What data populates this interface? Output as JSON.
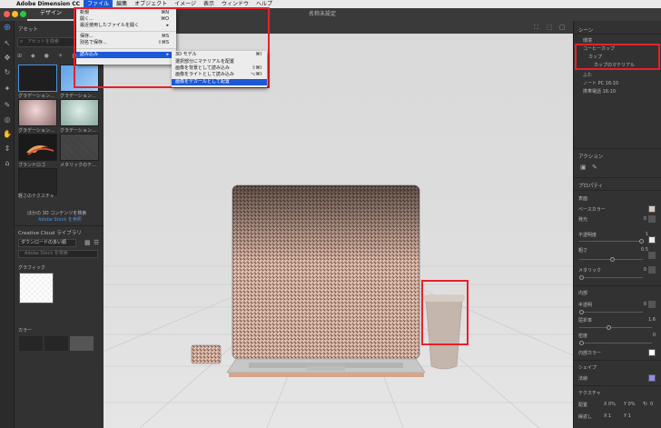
{
  "menubar": {
    "app": "Adobe Dimension CC",
    "items": [
      "ファイル",
      "編集",
      "オブジェクト",
      "イメージ",
      "表示",
      "ウィンドウ",
      "ヘルプ"
    ]
  },
  "window": {
    "title": "名称未設定",
    "tab": "デザイン"
  },
  "assets": {
    "title": "アセット",
    "search_placeholder": "アセットを検索",
    "thumbs": [
      "グラデーション…",
      "グラデーション…",
      "グラデーション…",
      "グラデーション…",
      "ブランドロゴ",
      "メタリックのテ…",
      "軽さのテクスチャ"
    ],
    "more_text": "ほかの 3D コンテンツを検索",
    "stock_link": "Adobe Stock を参照",
    "cc_title": "Creative Cloud ライブラリ",
    "cc_dropdown": "ダウンロードの多い順",
    "cc_search_placeholder": "Adobe Stock を検索",
    "group_graphics": "グラフィック",
    "group_colors": "カラー"
  },
  "file_menu": {
    "items": [
      {
        "label": "新規",
        "shortcut": "⌘N"
      },
      {
        "label": "開く...",
        "shortcut": "⌘O"
      },
      {
        "label": "最近使用したファイルを開く",
        "shortcut": "▸"
      },
      {
        "label": "保存...",
        "shortcut": "⌘S"
      },
      {
        "label": "別名で保存...",
        "shortcut": "⇧⌘S"
      },
      {
        "label": "読み込み",
        "shortcut": "▸"
      }
    ]
  },
  "import_submenu": {
    "items": [
      {
        "label": "3D モデル",
        "shortcut": "⌘I"
      },
      {
        "label": "選択部分にマテリアルを配置",
        "shortcut": ""
      },
      {
        "label": "画像を背景として読み込み",
        "shortcut": "⇧⌘I"
      },
      {
        "label": "画像をライトとして読み込み",
        "shortcut": "⌥⌘I"
      },
      {
        "label": "画像をデカールとして配置",
        "shortcut": ""
      }
    ]
  },
  "scene": {
    "title": "シーン",
    "items": [
      "環境",
      "コーヒーカップ",
      "カップ",
      "カップのマテリアル",
      "ふた",
      "ノート PC 16:10",
      "携帯電話 16:10"
    ]
  },
  "actions": {
    "title": "アクション"
  },
  "properties": {
    "title": "プロパティ",
    "surface": "表面",
    "base_color": "ベースカラー",
    "glow": "発光",
    "glow_value": "0",
    "opacity": "不透明度",
    "opacity_value": "1",
    "roughness": "粗さ",
    "roughness_value": "0.5",
    "metallic": "メタリック",
    "metallic_value": "0",
    "interior": "内部",
    "translucency": "半透明",
    "translucency_value": "0",
    "ior": "屈折率",
    "ior_value": "1.6",
    "density": "密度",
    "density_value": "0",
    "interior_color": "内部カラー",
    "sheen": "シェイプ",
    "normal": "法線",
    "texture": "テクスチャ",
    "offset": "配置",
    "offset_x": "X 0%",
    "offset_y": "Y 0%",
    "rotation": "0",
    "repeat": "繰返し",
    "repeat_x": "X 1",
    "repeat_y": "Y 1"
  }
}
